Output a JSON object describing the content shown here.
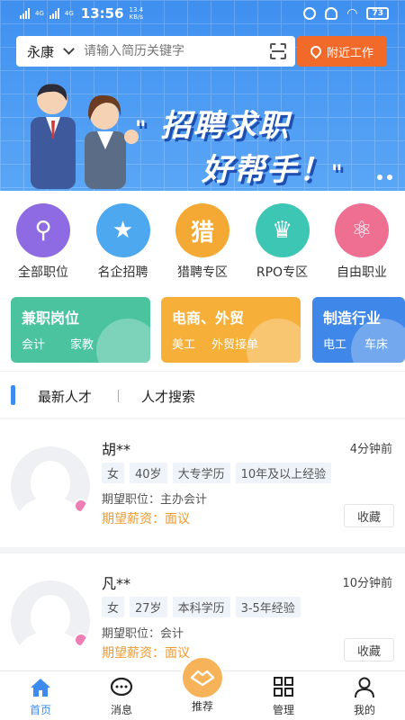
{
  "status_bar": {
    "net1": "4G",
    "net2": "4G",
    "time": "13:56",
    "speed_value": "13.4",
    "speed_unit": "KB/s",
    "battery": "73"
  },
  "search": {
    "city": "永康",
    "placeholder": "请输入简历关键字",
    "nearby_label": "附近工作"
  },
  "banner": {
    "line1": "招聘求职",
    "line2": "好帮手！",
    "quote_open": "\"",
    "quote_close": "\""
  },
  "categories": [
    {
      "label": "全部职位",
      "color": "#8f6be3",
      "glyph": "⚲"
    },
    {
      "label": "名企招聘",
      "color": "#4da8ef",
      "glyph": "★"
    },
    {
      "label": "猎聘专区",
      "color": "#f3a933",
      "glyph": "猎"
    },
    {
      "label": "RPO专区",
      "color": "#3dc6b4",
      "glyph": "♛"
    },
    {
      "label": "自由职业",
      "color": "#ef6f93",
      "glyph": "⚛"
    }
  ],
  "industry_cards": [
    {
      "title": "兼职岗位",
      "sub1": "会计",
      "sub2": "家教",
      "color": "#4bc39f"
    },
    {
      "title": "电商、外贸",
      "sub1": "美工",
      "sub2": "外贸接单",
      "color": "#f6b03a"
    },
    {
      "title": "制造行业",
      "sub1": "电工",
      "sub2": "车床",
      "color": "#3f87e8"
    }
  ],
  "tabs": {
    "latest": "最新人才",
    "search": "人才搜索"
  },
  "talents": [
    {
      "name": "胡**",
      "time": "4分钟前",
      "tags": [
        "女",
        "40岁",
        "大专学历",
        "10年及以上经验"
      ],
      "job": "期望职位：主办会计",
      "salary": "期望薪资：面议",
      "collect": "收藏"
    },
    {
      "name": "凡**",
      "time": "10分钟前",
      "tags": [
        "女",
        "27岁",
        "本科学历",
        "3-5年经验"
      ],
      "job": "期望职位：会计",
      "salary": "期望薪资：面议",
      "collect": "收藏"
    }
  ],
  "nav": {
    "home": "首页",
    "messages": "消息",
    "recommend": "推荐",
    "manage": "管理",
    "mine": "我的",
    "active_color": "#3d8bf0"
  }
}
